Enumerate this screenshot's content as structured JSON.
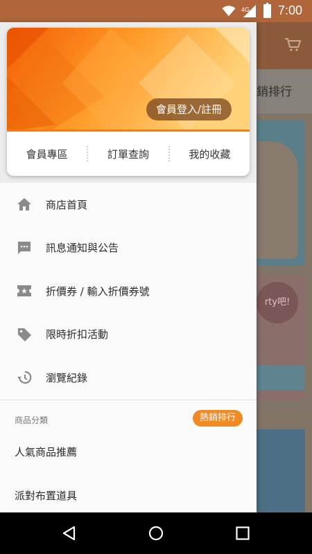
{
  "status_bar": {
    "time": "7:00",
    "network": "4G"
  },
  "background": {
    "tab_text": "銷排行",
    "banner_text": "rty吧!"
  },
  "drawer": {
    "login_label": "會員登入/註冊",
    "card_links": [
      "會員專區",
      "訂單查詢",
      "我的收藏"
    ],
    "menu": [
      {
        "label": "商店首頁",
        "icon": "home-icon"
      },
      {
        "label": "訊息通知與公告",
        "icon": "message-icon"
      },
      {
        "label": "折價券 / 輸入折價券號",
        "icon": "coupon-icon"
      },
      {
        "label": "限時折扣活動",
        "icon": "tag-icon"
      },
      {
        "label": "瀏覽紀錄",
        "icon": "history-icon"
      }
    ],
    "category_header": "商品分類",
    "hot_badge": "熱銷排行",
    "categories": [
      "人氣商品推薦",
      "派對布置道具"
    ]
  },
  "colors": {
    "accent": "#f08a24",
    "header_orange": "#ff8a1a"
  }
}
